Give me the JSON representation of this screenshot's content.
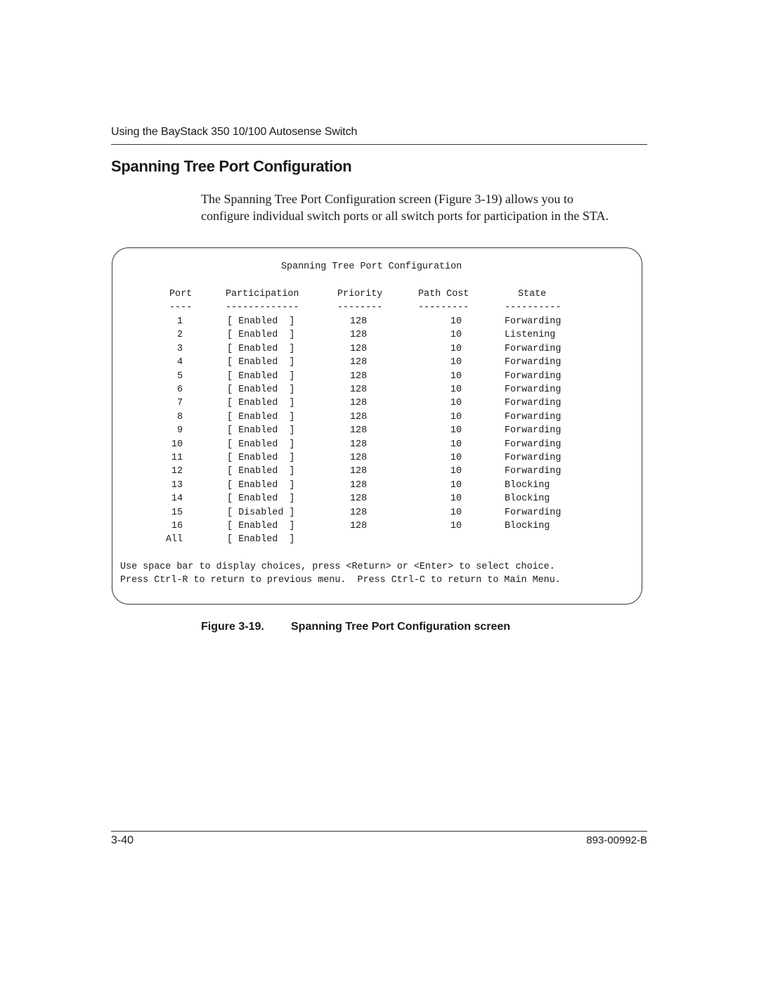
{
  "header": {
    "running_head": "Using the BayStack 350 10/100 Autosense Switch"
  },
  "section": {
    "title": "Spanning Tree Port Configuration",
    "intro_line1": "The Spanning Tree Port Configuration screen (Figure 3-19) allows you to",
    "intro_line2": "configure individual switch ports or all switch ports for participation in the STA."
  },
  "screen": {
    "title": "Spanning Tree Port Configuration",
    "columns": [
      "Port",
      "Participation",
      "Priority",
      "Path Cost",
      "State"
    ],
    "underlines": [
      "----",
      "-------------",
      "--------",
      "---------",
      "----------"
    ],
    "rows": [
      {
        "port": "1",
        "participation": "[ Enabled  ]",
        "priority": "128",
        "path_cost": "10",
        "state": "Forwarding"
      },
      {
        "port": "2",
        "participation": "[ Enabled  ]",
        "priority": "128",
        "path_cost": "10",
        "state": "Listening"
      },
      {
        "port": "3",
        "participation": "[ Enabled  ]",
        "priority": "128",
        "path_cost": "10",
        "state": "Forwarding"
      },
      {
        "port": "4",
        "participation": "[ Enabled  ]",
        "priority": "128",
        "path_cost": "10",
        "state": "Forwarding"
      },
      {
        "port": "5",
        "participation": "[ Enabled  ]",
        "priority": "128",
        "path_cost": "10",
        "state": "Forwarding"
      },
      {
        "port": "6",
        "participation": "[ Enabled  ]",
        "priority": "128",
        "path_cost": "10",
        "state": "Forwarding"
      },
      {
        "port": "7",
        "participation": "[ Enabled  ]",
        "priority": "128",
        "path_cost": "10",
        "state": "Forwarding"
      },
      {
        "port": "8",
        "participation": "[ Enabled  ]",
        "priority": "128",
        "path_cost": "10",
        "state": "Forwarding"
      },
      {
        "port": "9",
        "participation": "[ Enabled  ]",
        "priority": "128",
        "path_cost": "10",
        "state": "Forwarding"
      },
      {
        "port": "10",
        "participation": "[ Enabled  ]",
        "priority": "128",
        "path_cost": "10",
        "state": "Forwarding"
      },
      {
        "port": "11",
        "participation": "[ Enabled  ]",
        "priority": "128",
        "path_cost": "10",
        "state": "Forwarding"
      },
      {
        "port": "12",
        "participation": "[ Enabled  ]",
        "priority": "128",
        "path_cost": "10",
        "state": "Forwarding"
      },
      {
        "port": "13",
        "participation": "[ Enabled  ]",
        "priority": "128",
        "path_cost": "10",
        "state": "Blocking"
      },
      {
        "port": "14",
        "participation": "[ Enabled  ]",
        "priority": "128",
        "path_cost": "10",
        "state": "Blocking"
      },
      {
        "port": "15",
        "participation": "[ Disabled ]",
        "priority": "128",
        "path_cost": "10",
        "state": "Forwarding"
      },
      {
        "port": "16",
        "participation": "[ Enabled  ]",
        "priority": "128",
        "path_cost": "10",
        "state": "Blocking"
      },
      {
        "port": "All",
        "participation": "[ Enabled  ]",
        "priority": "",
        "path_cost": "",
        "state": ""
      }
    ],
    "hint_line1": "Use space bar to display choices, press <Return> or <Enter> to select choice.",
    "hint_line2": "Press Ctrl-R to return to previous menu.  Press Ctrl-C to return to Main Menu."
  },
  "figure": {
    "number": "Figure 3-19.",
    "caption": "Spanning Tree Port Configuration screen"
  },
  "footer": {
    "page_number": "3-40",
    "doc_number": "893-00992-B"
  }
}
